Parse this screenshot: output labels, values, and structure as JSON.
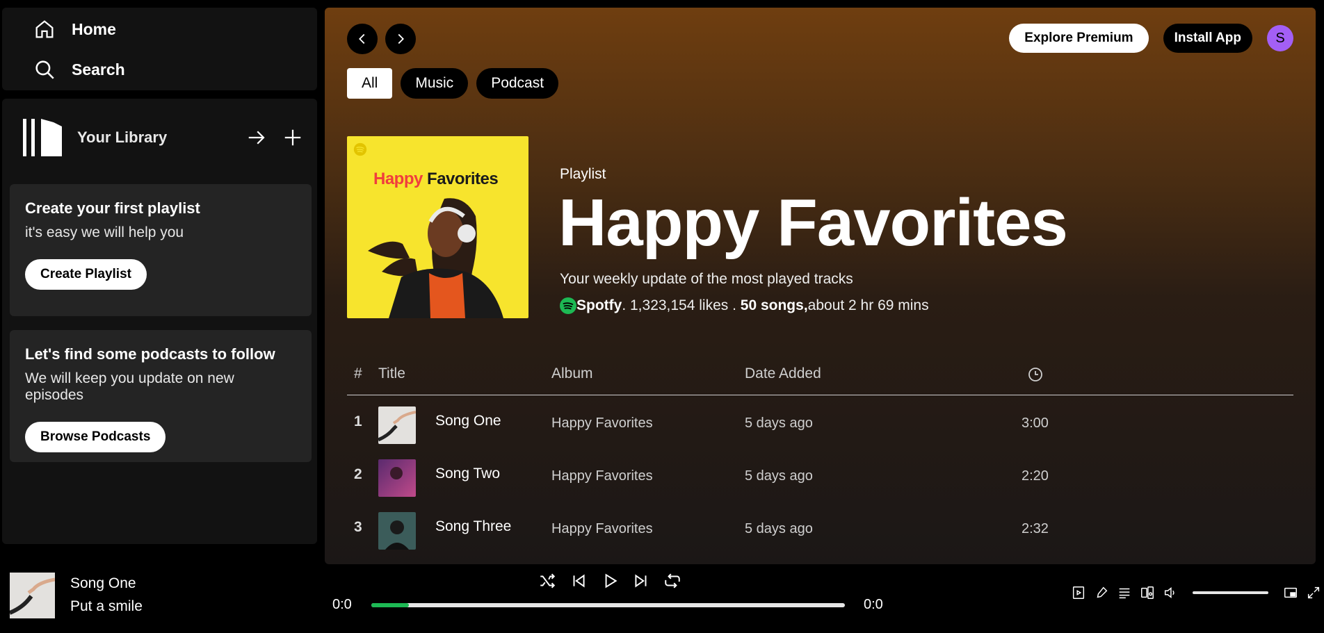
{
  "nav": {
    "home_label": "Home",
    "search_label": "Search"
  },
  "library": {
    "title": "Your Library",
    "cards": [
      {
        "title": "Create your first playlist",
        "desc": "it's easy we will help you",
        "button": "Create Playlist"
      },
      {
        "title": "Let's find some podcasts to follow",
        "desc": "We will keep you update on new episodes",
        "button": "Browse Podcasts"
      }
    ]
  },
  "header": {
    "explore_label": "Explore Premium",
    "install_label": "Install App",
    "avatar_letter": "S"
  },
  "filters": [
    "All",
    "Music",
    "Podcast"
  ],
  "playlist": {
    "cover_title_a": "Happy",
    "cover_title_b": "Favorites",
    "type": "Playlist",
    "title": "Happy Favorites",
    "description": "Your weekly update of the most played tracks",
    "owner": "Spotfy",
    "likes": ". 1,323,154 likes . ",
    "songs": "50 songs,",
    "duration": "about 2 hr 69 mins"
  },
  "table": {
    "headers": {
      "num": "#",
      "title": "Title",
      "album": "Album",
      "date": "Date Added"
    },
    "rows": [
      {
        "num": "1",
        "title": "Song One",
        "album": "Happy Favorites",
        "date": "5 days ago",
        "duration": "3:00"
      },
      {
        "num": "2",
        "title": "Song Two",
        "album": "Happy Favorites",
        "date": "5 days ago",
        "duration": "2:20"
      },
      {
        "num": "3",
        "title": "Song Three",
        "album": "Happy Favorites",
        "date": "5 days ago",
        "duration": "2:32"
      }
    ]
  },
  "player": {
    "track_title": "Song One",
    "track_artist": "Put a smile",
    "time_current": "0:0",
    "time_total": "0:0",
    "progress_fraction": 0.08
  },
  "colors": {
    "accent": "#1db954",
    "avatar": "#a35ff5"
  }
}
